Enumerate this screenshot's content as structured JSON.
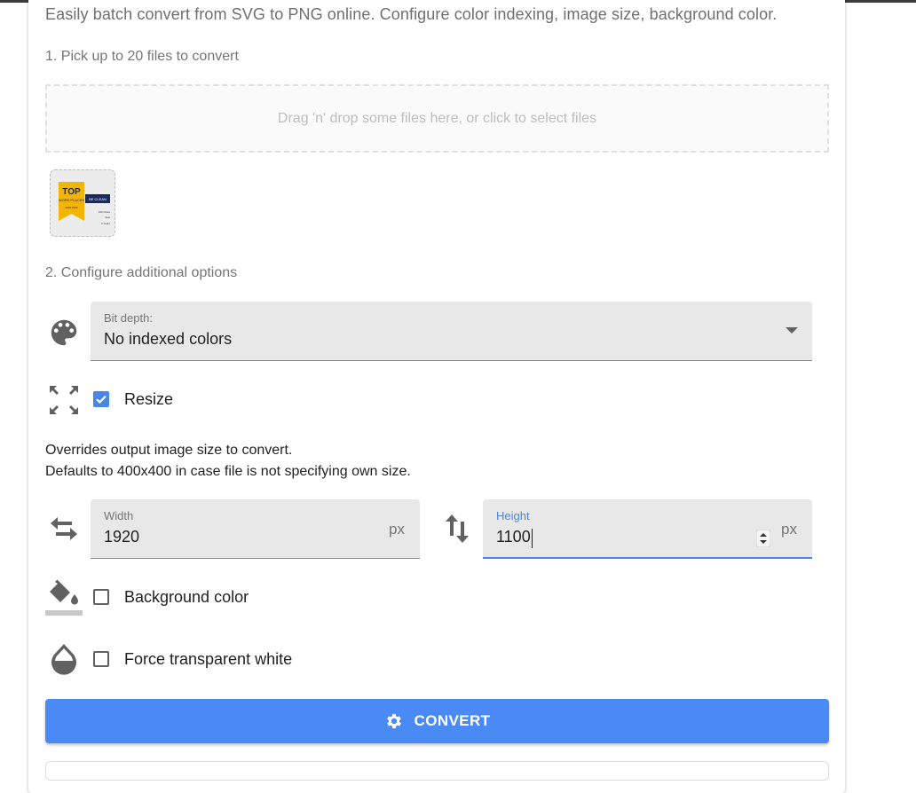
{
  "header": {
    "subtitle": "Easily batch convert from SVG to PNG online. Configure color indexing, image size, background color."
  },
  "step1": {
    "label": "1. Pick up to 20 files to convert",
    "dropzone_text": "Drag 'n' drop some files here, or click to select files",
    "thumbnail": {
      "badge_top": "TOP",
      "badge_sub": "WORK PLACES",
      "badge_year": "2019 2020",
      "brand": "BE CLEAN",
      "lines": [
        "100 Cities",
        "Year",
        "3 Years"
      ]
    }
  },
  "step2": {
    "label": "2. Configure additional options",
    "bit_depth": {
      "label": "Bit depth:",
      "value": "No indexed colors",
      "icon": "palette-icon"
    },
    "resize": {
      "label": "Resize",
      "checked": true,
      "icon": "fullscreen-icon"
    },
    "helper_line1": "Overrides output image size to convert.",
    "helper_line2": "Defaults to 400x400 in case file is not specifying own size.",
    "width": {
      "label": "Width",
      "value": "1920",
      "unit": "px",
      "icon": "swap-horizontal-icon"
    },
    "height": {
      "label": "Height",
      "value": "1100",
      "unit": "px",
      "icon": "swap-vertical-icon"
    },
    "background_color": {
      "label": "Background color",
      "checked": false,
      "icon": "format-color-fill-icon"
    },
    "force_transparent_white": {
      "label": "Force transparent white",
      "checked": false,
      "icon": "invert-colors-icon"
    }
  },
  "actions": {
    "convert_label": "CONVERT",
    "convert_icon": "gear-icon"
  },
  "colors": {
    "accent": "#4a8af4",
    "focus": "#4a86e8",
    "field_bg": "#e8e8e8"
  }
}
